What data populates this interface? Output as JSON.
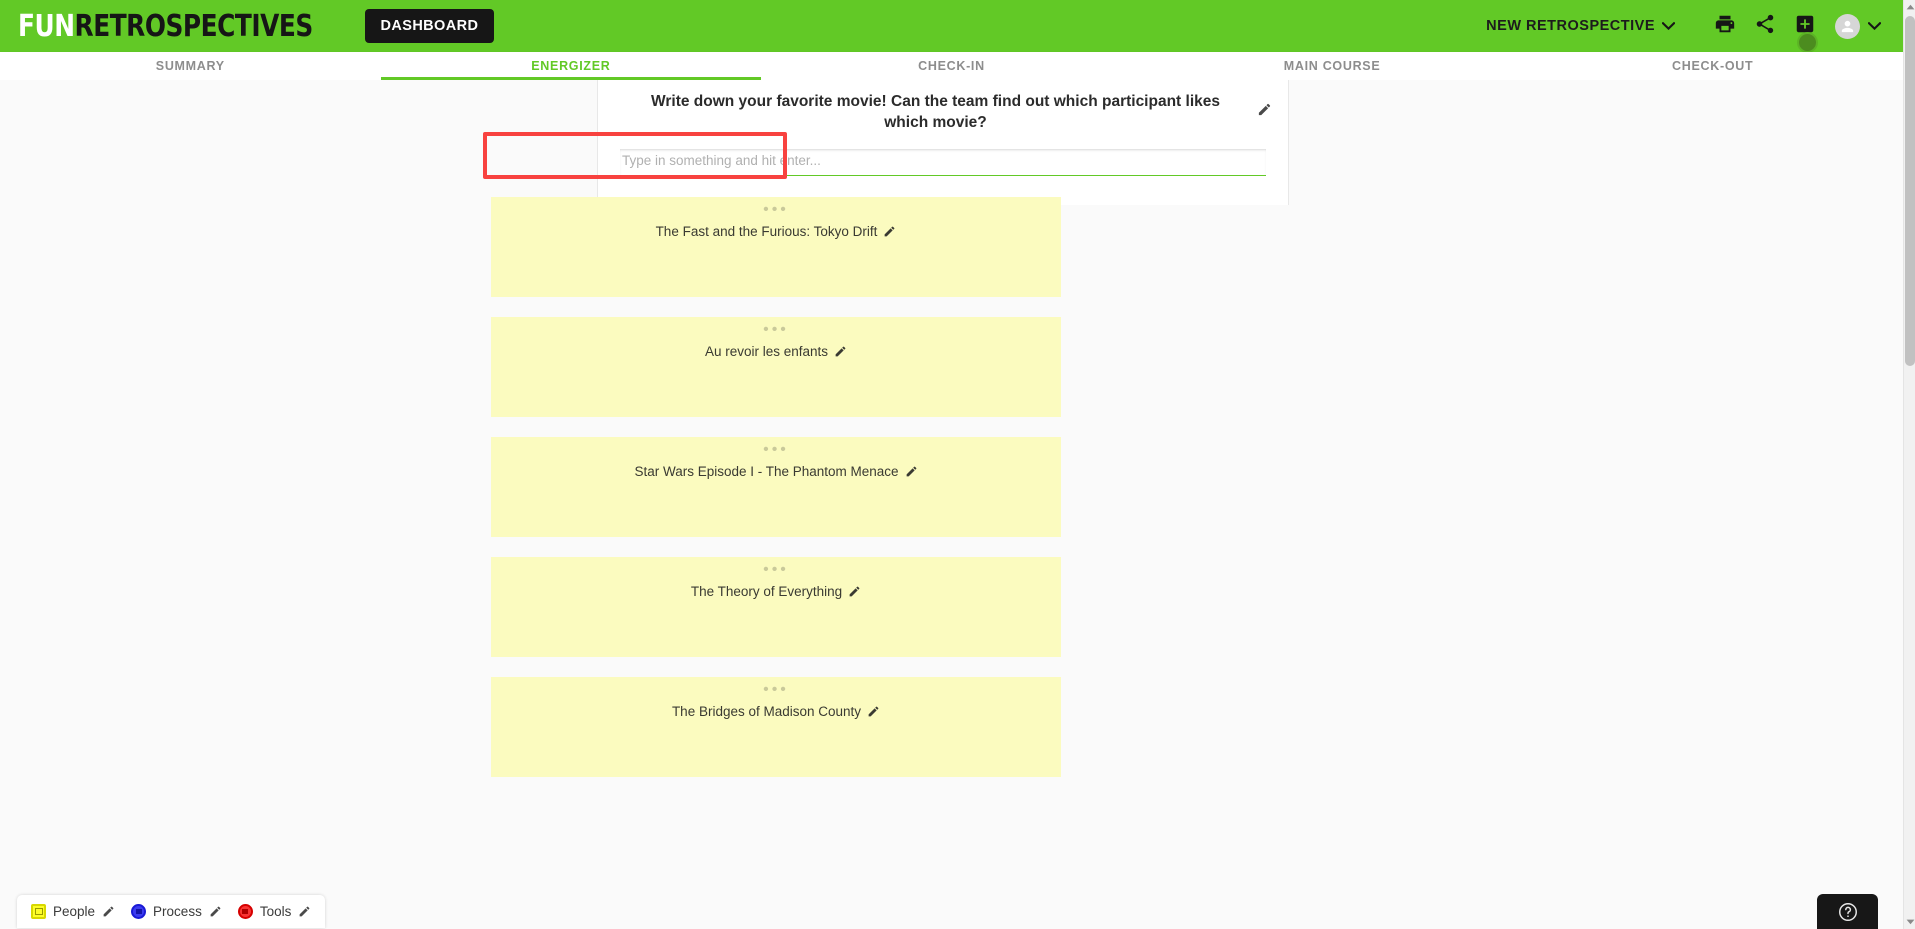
{
  "header": {
    "logo_fun": "FUN",
    "logo_rest": "RETROSPECTIVES",
    "dashboard_label": "DASHBOARD",
    "new_retrospective_label": "NEW RETROSPECTIVE",
    "icons": {
      "chevron": "chevron-down-icon",
      "print": "print-icon",
      "share": "share-icon",
      "add_box": "add-box-icon",
      "avatar": "avatar-icon"
    },
    "brand_color": "#62c926",
    "dashboard_bg": "#161616"
  },
  "tabs": [
    {
      "label": "SUMMARY",
      "active": false
    },
    {
      "label": "ENERGIZER",
      "active": true
    },
    {
      "label": "CHECK-IN",
      "active": false
    },
    {
      "label": "MAIN COURSE",
      "active": false
    },
    {
      "label": "CHECK-OUT",
      "active": false
    }
  ],
  "question": {
    "text": "Write down your favorite movie! Can the team find out which participant likes which movie?",
    "edit_icon": "pencil-icon"
  },
  "note_input": {
    "value": "",
    "placeholder": "Type in something and hit enter...",
    "underline_color": "#62c926",
    "highlight_color": "#f8423f"
  },
  "cards": [
    {
      "text": "The Fast and the Furious: Tokyo Drift",
      "handle": "•••",
      "edit_icon": "pencil-icon"
    },
    {
      "text": "Au revoir les enfants",
      "handle": "•••",
      "edit_icon": "pencil-icon"
    },
    {
      "text": "Star Wars Episode I - The Phantom Menace",
      "handle": "•••",
      "edit_icon": "pencil-icon"
    },
    {
      "text": "The Theory of Everything",
      "handle": "•••",
      "edit_icon": "pencil-icon"
    },
    {
      "text": "The Bridges of Madison County",
      "handle": "•••",
      "edit_icon": "pencil-icon"
    }
  ],
  "card_color": "#fbfbbf",
  "legend": [
    {
      "label": "People",
      "color": "#fdfd28",
      "shape": "square",
      "edit_icon": "pencil-icon"
    },
    {
      "label": "Process",
      "color": "#3c3cf0",
      "shape": "circle",
      "edit_icon": "pencil-icon"
    },
    {
      "label": "Tools",
      "color": "#f83434",
      "shape": "circle",
      "edit_icon": "pencil-icon"
    }
  ],
  "help": {
    "icon": "help-circle-icon"
  }
}
